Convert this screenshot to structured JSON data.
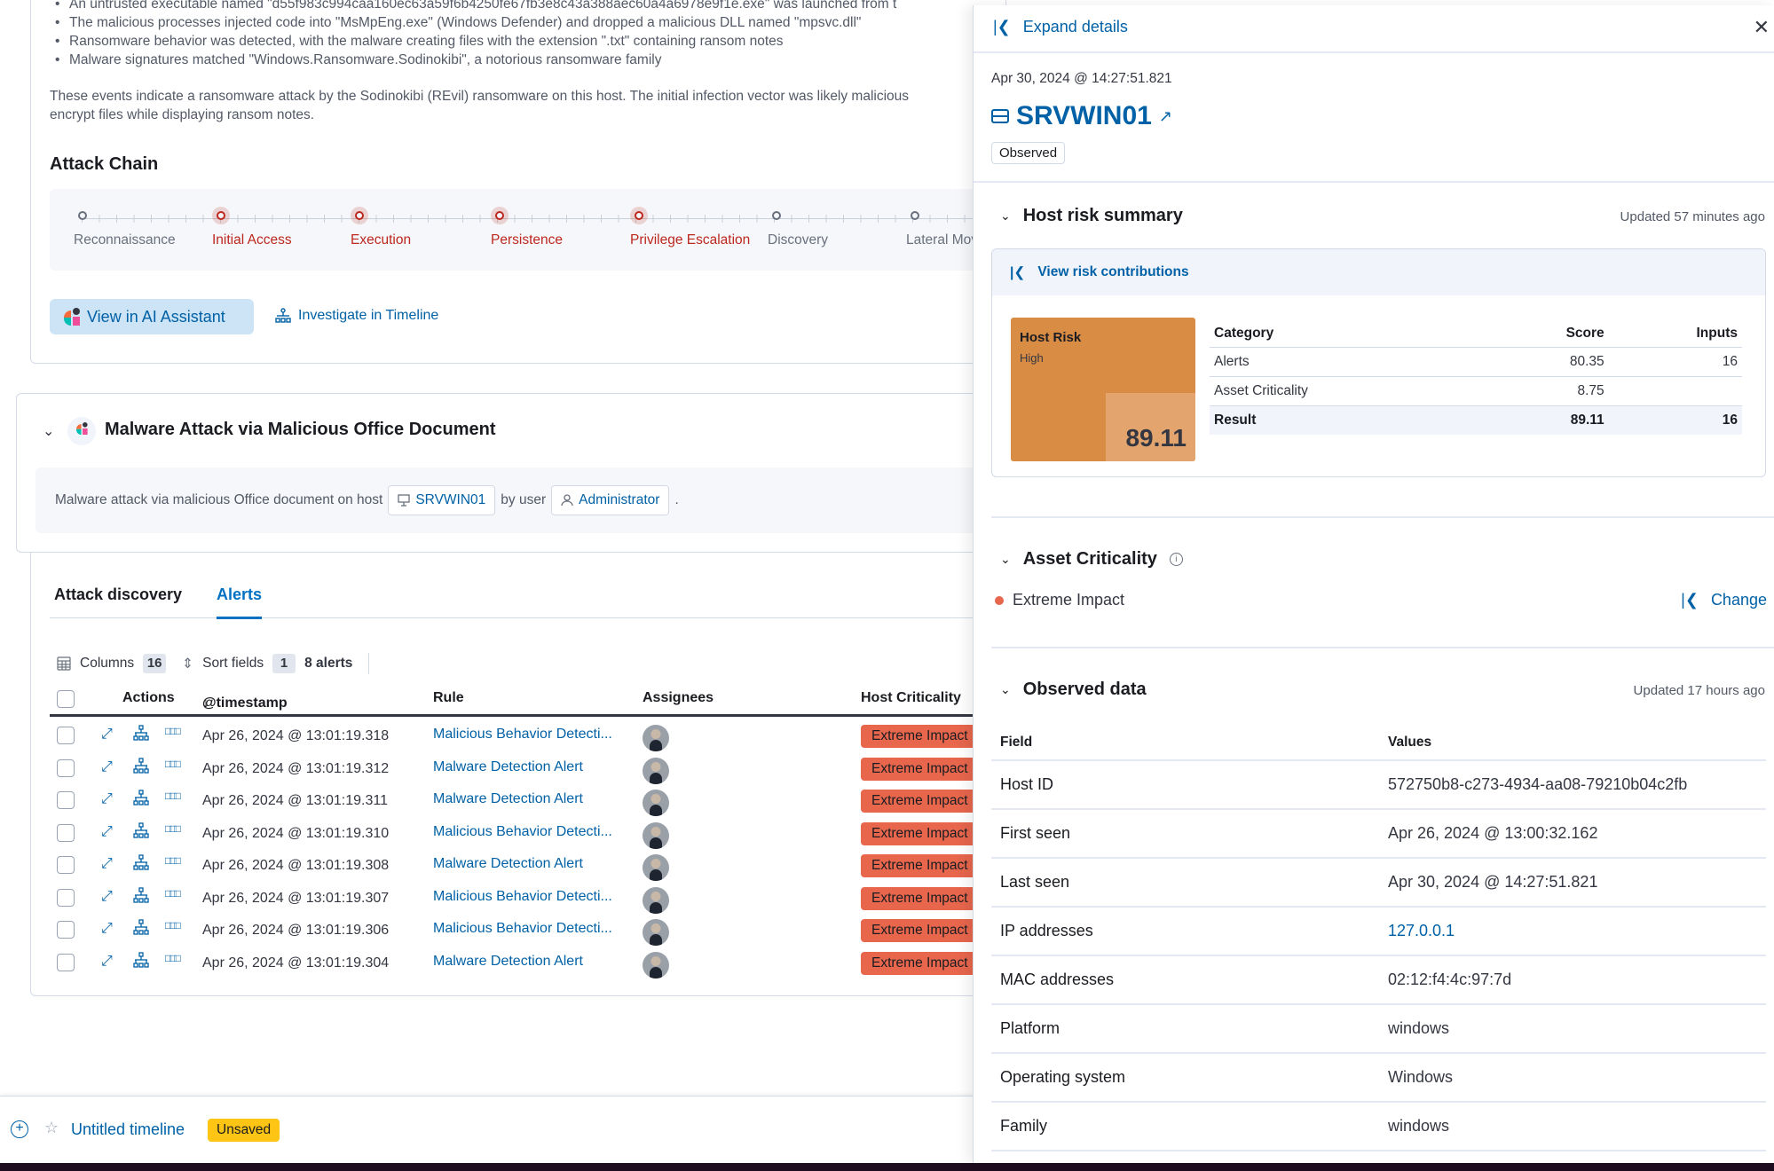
{
  "summary": {
    "bullets": [
      "An untrusted executable named \"d55f983c994caa160ec63a59f6b4250fe67fb3e8c43a388aec60a4a6978e9f1e.exe\" was launched from t",
      "The malicious processes injected code into \"MsMpEng.exe\" (Windows Defender) and dropped a malicious DLL named \"mpsvc.dll\"",
      "Ransomware behavior was detected, with the malware creating files with the extension \".txt\" containing ransom notes",
      "Malware signatures matched \"Windows.Ransomware.Sodinokibi\", a notorious ransomware family"
    ],
    "paragraph_line1": "These events indicate a ransomware attack by the Sodinokibi (REvil) ransomware on this host. The initial infection vector was likely malicious",
    "paragraph_line2": "encrypt files while displaying ransom notes."
  },
  "attack_chain": {
    "title": "Attack Chain",
    "stages": [
      {
        "label": "Reconnaissance",
        "active": false
      },
      {
        "label": "Initial Access",
        "active": true
      },
      {
        "label": "Execution",
        "active": true
      },
      {
        "label": "Persistence",
        "active": true
      },
      {
        "label": "Privilege Escalation",
        "active": true
      },
      {
        "label": "Discovery",
        "active": false
      },
      {
        "label": "Lateral Movement",
        "active": false
      }
    ],
    "view_ai_label": "View in AI Assistant",
    "investigate_label": "Investigate in Timeline"
  },
  "discovery": {
    "title": "Malware Attack via Malicious Office Document",
    "desc_prefix": "Malware attack via malicious Office document on host",
    "host": "SRVWIN01",
    "by_user": "by user",
    "user": "Administrator",
    "suffix": "."
  },
  "tabs": [
    {
      "label": "Attack discovery",
      "active": false
    },
    {
      "label": "Alerts",
      "active": true
    }
  ],
  "toolbar": {
    "columns_label": "Columns",
    "columns_count": "16",
    "sort_label": "Sort fields",
    "sort_count": "1",
    "alerts_count": "8 alerts"
  },
  "grid": {
    "headers": {
      "actions": "Actions",
      "timestamp": "@timestamp",
      "rule": "Rule",
      "assignees": "Assignees",
      "host_criticality": "Host Criticality"
    },
    "rows": [
      {
        "timestamp": "Apr 26, 2024 @ 13:01:19.318",
        "rule": "Malicious Behavior Detecti...",
        "criticality": "Extreme Impact"
      },
      {
        "timestamp": "Apr 26, 2024 @ 13:01:19.312",
        "rule": "Malware Detection Alert",
        "criticality": "Extreme Impact"
      },
      {
        "timestamp": "Apr 26, 2024 @ 13:01:19.311",
        "rule": "Malware Detection Alert",
        "criticality": "Extreme Impact"
      },
      {
        "timestamp": "Apr 26, 2024 @ 13:01:19.310",
        "rule": "Malicious Behavior Detecti...",
        "criticality": "Extreme Impact"
      },
      {
        "timestamp": "Apr 26, 2024 @ 13:01:19.308",
        "rule": "Malware Detection Alert",
        "criticality": "Extreme Impact"
      },
      {
        "timestamp": "Apr 26, 2024 @ 13:01:19.307",
        "rule": "Malicious Behavior Detecti...",
        "criticality": "Extreme Impact"
      },
      {
        "timestamp": "Apr 26, 2024 @ 13:01:19.306",
        "rule": "Malicious Behavior Detecti...",
        "criticality": "Extreme Impact"
      },
      {
        "timestamp": "Apr 26, 2024 @ 13:01:19.304",
        "rule": "Malware Detection Alert",
        "criticality": "Extreme Impact"
      }
    ]
  },
  "timeline_bar": {
    "title": "Untitled timeline",
    "badge": "Unsaved"
  },
  "flyout": {
    "expand_label": "Expand details",
    "date": "Apr 30, 2024 @ 14:27:51.821",
    "host_name": "SRVWIN01",
    "observed_badge": "Observed",
    "risk_summary": {
      "title": "Host risk summary",
      "updated": "Updated 57 minutes ago",
      "view_contributions": "View risk contributions",
      "tile_title": "Host Risk",
      "tile_level": "High",
      "tile_score": "89.11",
      "table_headers": [
        "Category",
        "Score",
        "Inputs"
      ],
      "rows": [
        {
          "category": "Alerts",
          "score": "80.35",
          "inputs": "16"
        },
        {
          "category": "Asset Criticality",
          "score": "8.75",
          "inputs": ""
        }
      ],
      "result": {
        "category": "Result",
        "score": "89.11",
        "inputs": "16"
      }
    },
    "asset_criticality": {
      "title": "Asset Criticality",
      "value": "Extreme Impact",
      "change_label": "Change"
    },
    "observed_data": {
      "title": "Observed data",
      "updated": "Updated 17 hours ago",
      "headers": [
        "Field",
        "Values"
      ],
      "rows": [
        {
          "field": "Host ID",
          "value": "572750b8-c273-4934-aa08-79210b04c2fb",
          "link": false
        },
        {
          "field": "First seen",
          "value": "Apr 26, 2024 @ 13:00:32.162",
          "link": false
        },
        {
          "field": "Last seen",
          "value": "Apr 30, 2024 @ 14:27:51.821",
          "link": false
        },
        {
          "field": "IP addresses",
          "value": "127.0.0.1",
          "link": true
        },
        {
          "field": "MAC addresses",
          "value": "02:12:f4:4c:97:7d",
          "link": false
        },
        {
          "field": "Platform",
          "value": "windows",
          "link": false
        },
        {
          "field": "Operating system",
          "value": "Windows",
          "link": false
        },
        {
          "field": "Family",
          "value": "windows",
          "link": false
        }
      ]
    }
  },
  "colors": {
    "link": "#0061a6",
    "danger": "#bd271e",
    "extreme_impact": "#e7664c",
    "risk_high": "#d98c44",
    "unsaved": "#fec514"
  }
}
